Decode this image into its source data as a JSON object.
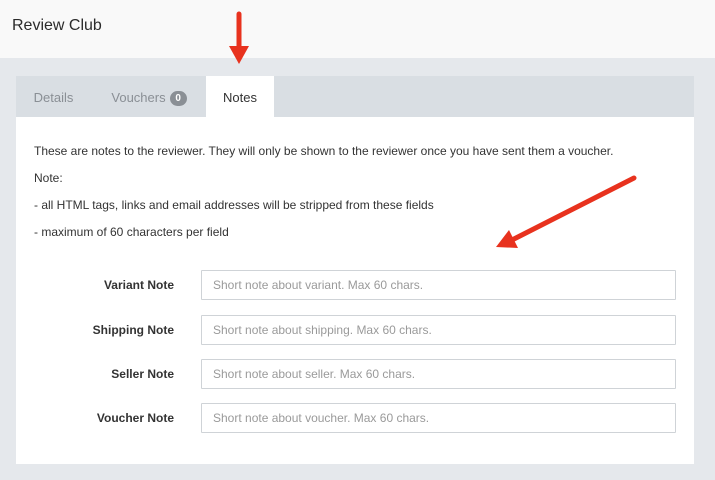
{
  "app": {
    "title": "Review Club"
  },
  "tabs": [
    {
      "label": "Details"
    },
    {
      "label": "Vouchers",
      "badge": "0"
    },
    {
      "label": "Notes"
    }
  ],
  "notes": {
    "intro": "These are notes to the reviewer. They will only be shown to the reviewer once you have sent them a voucher.",
    "note_heading": "Note:",
    "rules": [
      "- all HTML tags, links and email addresses will be stripped from these fields",
      "- maximum of 60 characters per field"
    ]
  },
  "fields": [
    {
      "label": "Variant Note",
      "placeholder": "Short note about variant. Max 60 chars.",
      "value": ""
    },
    {
      "label": "Shipping Note",
      "placeholder": "Short note about shipping. Max 60 chars.",
      "value": ""
    },
    {
      "label": "Seller Note",
      "placeholder": "Short note about seller. Max 60 chars.",
      "value": ""
    },
    {
      "label": "Voucher Note",
      "placeholder": "Short note about voucher. Max 60 chars.",
      "value": ""
    }
  ],
  "annotations": {
    "arrow_color": "#e8321e"
  }
}
